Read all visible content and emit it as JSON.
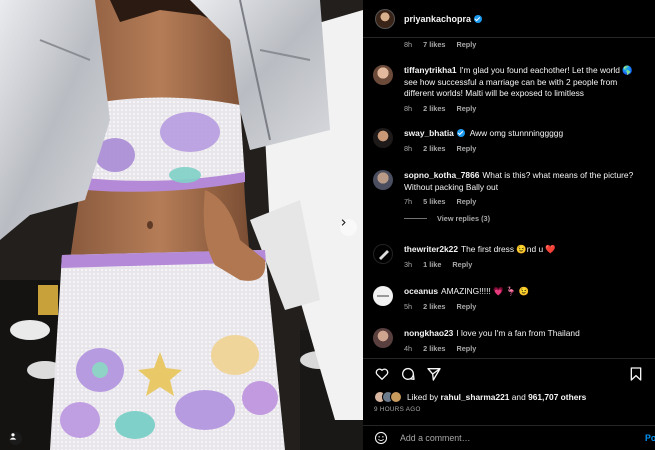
{
  "post": {
    "author": "priyankachopra",
    "author_verified": true
  },
  "comments": [
    {
      "user": "",
      "text": "",
      "time": "8h",
      "likes": "7 likes",
      "reply": "Reply",
      "partial": true
    },
    {
      "user": "tiffanytrikha1",
      "text": "I'm glad you found eachother! Let the world 🌎 see how successful a marriage can be with 2 people from different worlds! Malti will be exposed to limitless",
      "time": "8h",
      "likes": "2 likes",
      "reply": "Reply"
    },
    {
      "user": "sway_bhatia",
      "verified": true,
      "text": "Aww omg stunnninggggg",
      "time": "8h",
      "likes": "2 likes",
      "reply": "Reply"
    },
    {
      "user": "sopno_kotha_7866",
      "text": "What is this? what means of the picture? Without packing Bally out",
      "time": "7h",
      "likes": "5 likes",
      "reply": "Reply",
      "view_replies": "View replies (3)"
    },
    {
      "user": "thewriter2k22",
      "text": "The first dress 😉nd u ❤️",
      "time": "3h",
      "likes": "1 like",
      "reply": "Reply"
    },
    {
      "user": "oceanus",
      "text": "AMAZING!!!!! 💗 🦩 😉",
      "time": "5h",
      "likes": "2 likes",
      "reply": "Reply"
    },
    {
      "user": "nongkhao23",
      "text": "I love you I'm a fan from Thailand",
      "time": "4h",
      "likes": "2 likes",
      "reply": "Reply"
    }
  ],
  "actions": {
    "liked_by_prefix": "Liked by",
    "liked_by_user": "rahul_sharma221",
    "liked_by_and": "and",
    "liked_by_count": "961,707 others",
    "time_ago": "9 HOURS AGO"
  },
  "add_comment": {
    "placeholder": "Add a comment…",
    "post_label": "Post"
  },
  "colors": {
    "accent": "#0095f6",
    "verified": "#1d9bf0",
    "heart": "#ff3040"
  },
  "icons": [
    "heart-icon",
    "comment-icon",
    "share-icon",
    "bookmark-icon",
    "emoji-icon",
    "verified-icon",
    "next-arrow-icon",
    "tag-user-icon"
  ]
}
